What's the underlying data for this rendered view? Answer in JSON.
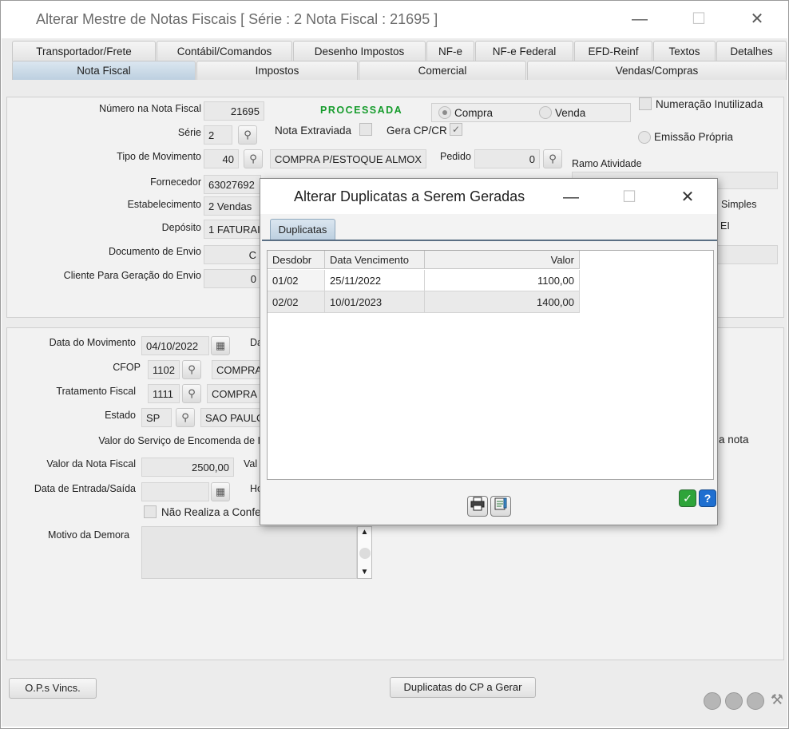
{
  "window": {
    "title": "Alterar Mestre de Notas Fiscais [ Série : 2   Nota Fiscal : 21695 ]",
    "minimize": "—",
    "maximize": "☐",
    "close": "✕"
  },
  "tabs_top": [
    "Transportador/Frete",
    "Contábil/Comandos",
    "Desenho Impostos",
    "NF-e",
    "NF-e Federal",
    "EFD-Reinf",
    "Textos",
    "Detalhes"
  ],
  "tabs_bottom": [
    "Nota Fiscal",
    "Impostos",
    "Comercial",
    "Vendas/Compras"
  ],
  "header": {
    "numero_label": "Número na Nota Fiscal",
    "numero_value": "21695",
    "status": "PROCESSADA",
    "compra_label": "Compra",
    "venda_label": "Venda",
    "numeracao_label": "Numeração Inutilizada",
    "serie_label": "Série",
    "serie_value": "2",
    "extraviada_label": "Nota Extraviada",
    "gera_label": "Gera CP/CR",
    "gera_check": "✓",
    "emissao_label": "Emissão Própria",
    "tipo_label": "Tipo de Movimento",
    "tipo_value": "40",
    "tipo_desc": "COMPRA P/ESTOQUE ALMOX",
    "pedido_label": "Pedido",
    "pedido_value": "0",
    "ramo_label": "Ramo Atividade",
    "fornecedor_label": "Fornecedor",
    "fornecedor_value": "63027692",
    "estab_label": "Estabelecimento",
    "estab_value": "2 Vendas",
    "simples_label": "Simples",
    "deposito_label": "Depósito",
    "deposito_value": "1 FATURAI",
    "mei_label": "EI",
    "doc_envio_label": "Documento de Envio",
    "doc_envio_value": "C",
    "cliente_label": "Cliente Para Geração do Envio",
    "cliente_value": "0"
  },
  "movimento": {
    "data_mov_label": "Data do Movimento",
    "data_mov_value": "04/10/2022",
    "da_label": "Da",
    "cfop_label": "CFOP",
    "cfop_value": "1102",
    "cfop_desc": "COMPRA",
    "trat_label": "Tratamento Fiscal",
    "trat_value": "1111",
    "trat_desc": "COMPRA F",
    "estado_label": "Estado",
    "estado_value": "SP",
    "estado_desc": "SAO PAULO",
    "servico_label": "Valor do Serviço de Encomenda de I",
    "a_nota_label": "a nota",
    "valor_nf_label": "Valor da Nota Fiscal",
    "valor_nf_value": "2500,00",
    "val_label": "Val",
    "entrada_label": "Data de Entrada/Saída",
    "ho_label": "Ho",
    "nao_realiza_label": "Não Realiza a Confe",
    "motivo_label": "Motivo da Demora"
  },
  "footer": {
    "ops_button": "O.P.s Vincs.",
    "duplicatas_button": "Duplicatas do CP a Gerar"
  },
  "dialog": {
    "title": "Alterar Duplicatas a Serem Geradas",
    "minimize": "—",
    "maximize": "☐",
    "close": "✕",
    "tab": "Duplicatas",
    "columns": [
      "Desdobr",
      "Data Vencimento",
      "Valor"
    ],
    "rows": [
      {
        "desdobr": "01/02",
        "vencimento": "25/11/2022",
        "valor": "1100,00"
      },
      {
        "desdobr": "02/02",
        "vencimento": "10/01/2023",
        "valor": "1400,00"
      }
    ],
    "print_icon": "print-icon",
    "edit_icon": "edit-icon",
    "ok_icon": "check-icon",
    "help_icon": "help-icon"
  },
  "colors": {
    "status_green": "#169c2c",
    "active_tab": "#bdd0e0",
    "ok_green": "#2ea43a",
    "help_blue": "#1f6fd0"
  }
}
